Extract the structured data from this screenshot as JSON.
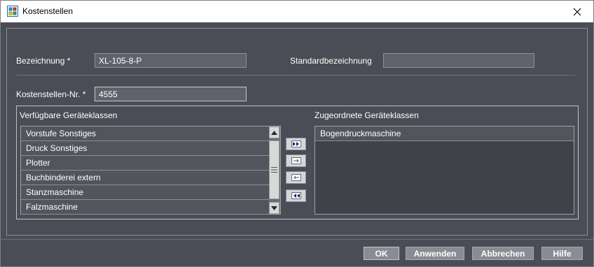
{
  "window": {
    "title": "Kostenstellen"
  },
  "form": {
    "bezeichnung_label": "Bezeichnung *",
    "bezeichnung_value": "XL-105-8-P",
    "standard_label": "Standardbezeichnung",
    "standard_value": "",
    "kostenstelle_label": "Kostenstellen-Nr. *",
    "kostenstelle_value": "4555"
  },
  "available": {
    "title": "Verfügbare Geräteklassen",
    "items": [
      "Vorstufe Sonstiges",
      "Druck Sonstiges",
      "Plotter",
      "Buchbinderei extern",
      "Stanzmaschine",
      "Falzmaschine"
    ]
  },
  "assigned": {
    "title": "Zugeordnete Geräteklassen",
    "items": [
      "Bogendruckmaschine"
    ]
  },
  "move_buttons": {
    "icons": [
      "add-all-icon",
      "add-selected-icon",
      "remove-selected-icon",
      "remove-all-icon"
    ]
  },
  "buttons": {
    "ok": "OK",
    "apply": "Anwenden",
    "cancel": "Abbrechen",
    "help": "Hilfe"
  },
  "colors": {
    "background": "#4a4d55",
    "list_item": "#52555c",
    "field": "#5f626a",
    "button": "#898c94"
  }
}
